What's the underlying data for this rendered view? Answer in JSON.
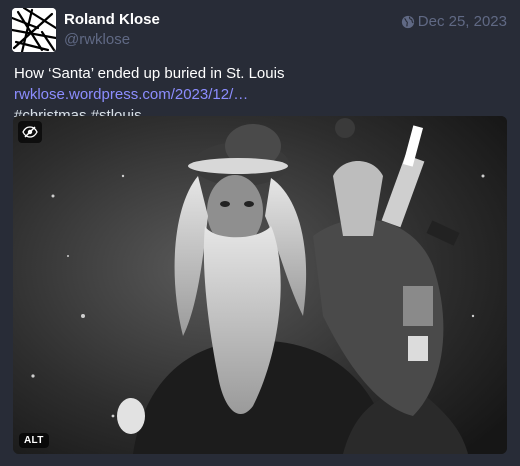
{
  "post": {
    "display_name": "Roland Klose",
    "handle": "@rwklose",
    "timestamp": "Dec 25, 2023",
    "visibility_icon": "globe-icon",
    "text_prefix": "How ‘Santa’ ended up buried in St. Louis ",
    "link_text": "rwklose.wordpress.com/2023/12/…",
    "hashtags": [
      "#christmas",
      "#stlouis"
    ]
  },
  "media": {
    "hide_icon": "eye-slash-icon",
    "alt_label": "ALT"
  },
  "colors": {
    "background": "#282c37",
    "link": "#8c8dff",
    "muted": "#606984"
  }
}
